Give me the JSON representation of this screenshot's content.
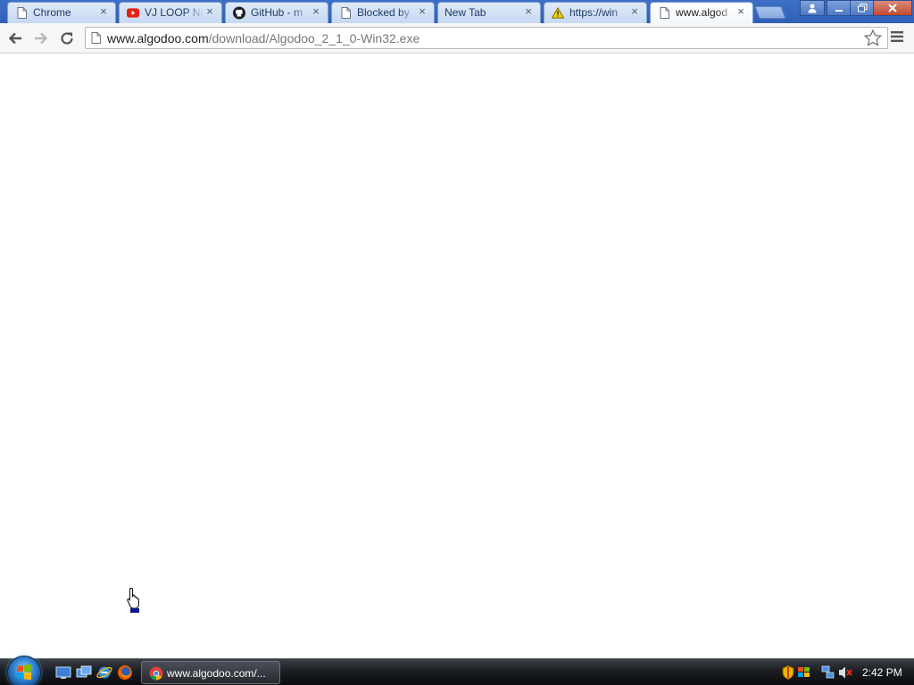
{
  "browser": {
    "tabs": [
      {
        "label": "Chrome",
        "icon": "page-icon",
        "active": false
      },
      {
        "label": "VJ LOOP NE",
        "icon": "youtube-icon",
        "active": false
      },
      {
        "label": "GitHub - m",
        "icon": "github-icon",
        "active": false
      },
      {
        "label": "Blocked by",
        "icon": "page-icon",
        "active": false
      },
      {
        "label": "New Tab",
        "icon": "",
        "active": false
      },
      {
        "label": "https://win",
        "icon": "warning-icon",
        "active": false
      },
      {
        "label": "www.algod",
        "icon": "page-icon",
        "active": true
      }
    ],
    "omnibox": {
      "host": "www.algodoo.com",
      "path": "/download/Algodoo_2_1_0-Win32.exe"
    },
    "close_glyph": "×"
  },
  "taskbar": {
    "task_label": "www.algodoo.com/...",
    "clock": "2:42 PM"
  },
  "colors": {
    "tabstrip": "#3768bf",
    "tab_inactive": "#c7d9f3",
    "taskbar": "#1b1e22",
    "youtube_red": "#e62117",
    "warning_yellow": "#f5d20a"
  }
}
